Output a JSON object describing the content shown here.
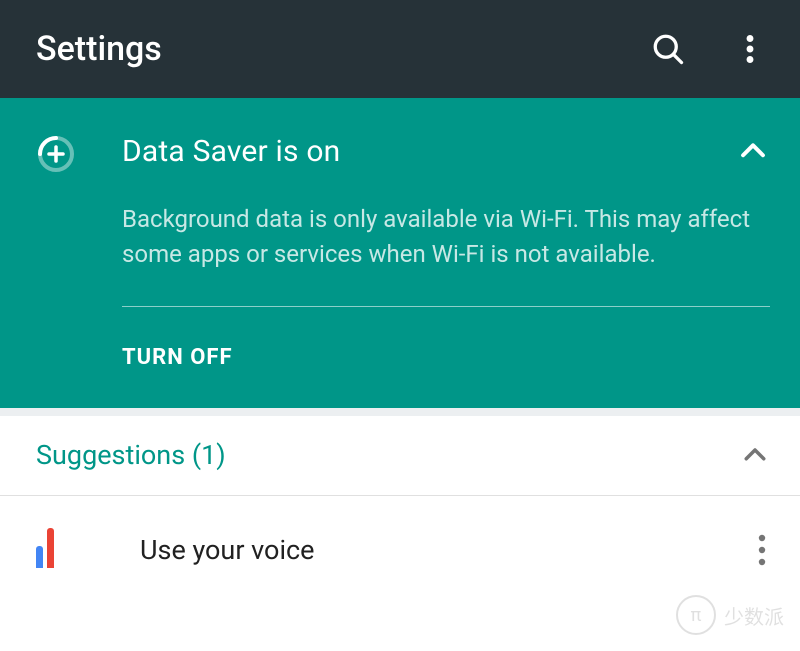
{
  "appbar": {
    "title": "Settings"
  },
  "banner": {
    "title": "Data Saver is on",
    "description": "Background data is only available via Wi-Fi. This may affect some apps or services when Wi-Fi is not available.",
    "action_label": "TURN OFF"
  },
  "suggestions": {
    "header": "Suggestions (1)",
    "items": [
      {
        "label": "Use your voice"
      }
    ]
  },
  "watermark": "少数派"
}
